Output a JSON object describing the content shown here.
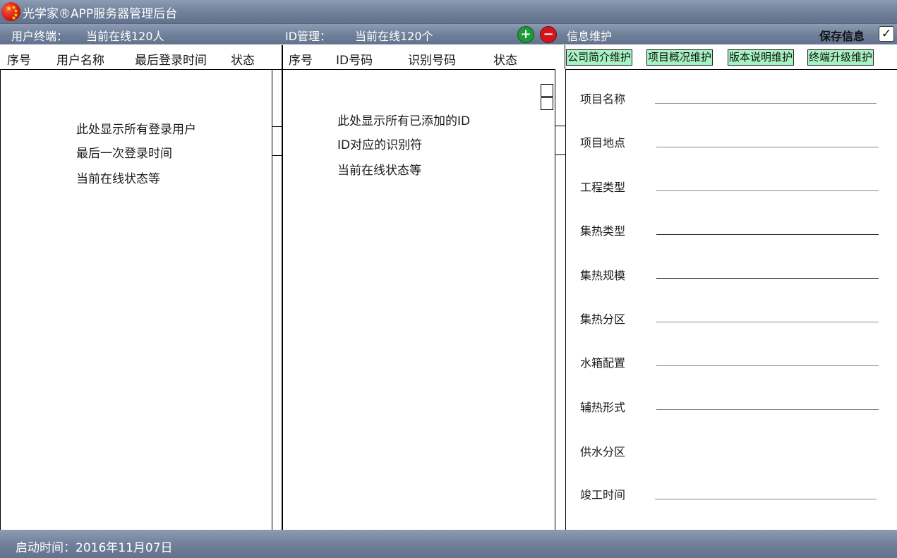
{
  "app": {
    "title": "光学家®APP服务器管理后台"
  },
  "header": {
    "user_terminal_label": "用户终端：",
    "user_online": "当前在线120人",
    "id_manage_label": "ID管理：",
    "id_online": "当前在线120个",
    "add_symbol": "+",
    "remove_symbol": "−",
    "info_maintenance": "信息维护",
    "save_label": "保存信息",
    "save_checked": true,
    "check_symbol": "✓"
  },
  "user_table": {
    "columns": [
      "序号",
      "用户名称",
      "最后登录时间",
      "状态"
    ],
    "placeholder_lines": [
      "此处显示所有登录用户",
      "最后一次登录时间",
      "当前在线状态等"
    ]
  },
  "id_table": {
    "columns": [
      "序号",
      "ID号码",
      "识别号码",
      "状态"
    ],
    "placeholder_lines": [
      "此处显示所有已添加的ID",
      "ID对应的识别符",
      "当前在线状态等"
    ]
  },
  "tabs": [
    "公司简介维护",
    "项目概况维护",
    "版本说明维护",
    "终端升级维护"
  ],
  "form": {
    "fields": [
      "项目名称",
      "项目地点",
      "工程类型",
      "集热类型",
      "集热规模",
      "集热分区",
      "水箱配置",
      "辅热形式",
      "供水分区",
      "竣工时间"
    ]
  },
  "status": {
    "start_time": "启动时间：2016年11月07日"
  },
  "colors": {
    "bar": "#6f7f99",
    "tab_bg": "#a6f2c2",
    "add_button": "#1f9a3a",
    "remove_button": "#d3141c",
    "flag": "#c8140c"
  }
}
